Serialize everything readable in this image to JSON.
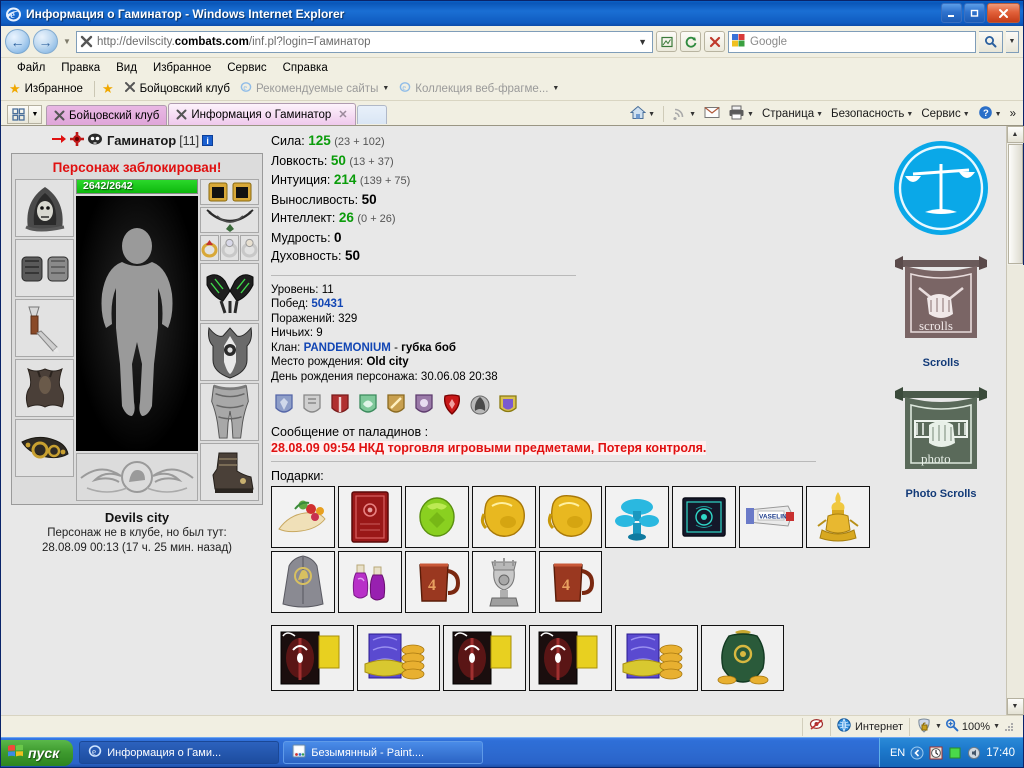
{
  "window": {
    "title": "Информация о Гаминатор - Windows Internet Explorer",
    "minimize": "–",
    "maximize": "□",
    "close": "✕"
  },
  "address": {
    "url_prefix": "http://devilscity.",
    "url_domain": "combats.com",
    "url_suffix": "/inf.pl?login=Гаминатор",
    "back_tooltip": "Назад",
    "forward_tooltip": "Вперед"
  },
  "search": {
    "placeholder": "Google"
  },
  "menu": {
    "items": [
      "Файл",
      "Правка",
      "Вид",
      "Избранное",
      "Сервис",
      "Справка"
    ]
  },
  "favorites_bar": {
    "favorites_label": "Избранное",
    "items": [
      {
        "label": "Бойцовский клуб",
        "dim": false,
        "caret": false
      },
      {
        "label": "Рекомендуемые сайты",
        "dim": true,
        "caret": true
      },
      {
        "label": "Коллекция веб-фрагме...",
        "dim": true,
        "caret": true
      }
    ]
  },
  "tabs": [
    {
      "label": "Бойцовский клуб",
      "active": false,
      "closable": false
    },
    {
      "label": "Информация о Гаминатор",
      "active": true,
      "closable": true
    }
  ],
  "command_bar": {
    "items": [
      {
        "label": "",
        "icon": "home-icon",
        "caret": true
      },
      {
        "label": "",
        "icon": "feeds-icon",
        "caret": true
      },
      {
        "label": "",
        "icon": "mail-icon",
        "caret": false
      },
      {
        "label": "",
        "icon": "print-icon",
        "caret": true
      },
      {
        "label": "Страница",
        "icon": "",
        "caret": true
      },
      {
        "label": "Безопасность",
        "icon": "",
        "caret": true
      },
      {
        "label": "Сервис",
        "icon": "",
        "caret": true
      },
      {
        "label": "",
        "icon": "help-icon",
        "caret": true
      }
    ],
    "overflow": "»"
  },
  "character": {
    "name": "Гаминатор",
    "level_bracket": "[11]",
    "info_badge": "i",
    "blocked_notice": "Персонаж заблокирован!",
    "hp": "2642/2642",
    "hp_percent": 100,
    "city": "Devils city",
    "club_line1": "Персонаж не в клубе, но был тут:",
    "club_line2": "28.08.09 00:13 (17 ч. 25 мин. назад)",
    "equipment_left": [
      "hood-item",
      "bracers-item",
      "dagger-item",
      "pelt-item",
      "belt-item"
    ],
    "equipment_right": [
      "earrings-item",
      "necklace-item",
      "rings-item",
      "gloves-item",
      "shield-item",
      "legs-item",
      "boots-item"
    ]
  },
  "stats": [
    {
      "label": "Сила:",
      "value": "125",
      "green": true,
      "detail": "(23 + 102)"
    },
    {
      "label": "Ловкость:",
      "value": "50",
      "green": true,
      "detail": "(13 + 37)"
    },
    {
      "label": "Интуиция:",
      "value": "214",
      "green": true,
      "detail": "(139 + 75)"
    },
    {
      "label": "Выносливость:",
      "value": "50",
      "green": false,
      "detail": ""
    },
    {
      "label": "Интеллект:",
      "value": "26",
      "green": true,
      "detail": "(0 + 26)"
    },
    {
      "label": "Мудрость:",
      "value": "0",
      "green": false,
      "detail": ""
    },
    {
      "label": "Духовность:",
      "value": "50",
      "green": false,
      "detail": ""
    }
  ],
  "profile": {
    "level_label": "Уровень:",
    "level_value": "11",
    "wins_label": "Побед:",
    "wins_value": "50431",
    "losses_label": "Поражений:",
    "losses_value": "329",
    "draws_label": "Ничьих:",
    "draws_value": "9",
    "clan_label": "Клан:",
    "clan_name": "PANDEMONIUM",
    "clan_sep": " - ",
    "clan_member": "губка боб",
    "birthplace_label": "Место рождения:",
    "birthplace_value": "Old city",
    "birthday_label": "День рождения персонажа:",
    "birthday_value": "30.06.08 20:38"
  },
  "medals": [
    {
      "name": "medal-blue",
      "color": "#8e9ec8",
      "accent": "#5566a8"
    },
    {
      "name": "medal-silver",
      "color": "#cfcfcf",
      "accent": "#888888"
    },
    {
      "name": "medal-red",
      "color": "#b03030",
      "accent": "#7a1c1c"
    },
    {
      "name": "medal-green",
      "color": "#7fc89a",
      "accent": "#3a8a5c"
    },
    {
      "name": "medal-gold",
      "color": "#c8a050",
      "accent": "#8a6a20"
    },
    {
      "name": "medal-purple",
      "color": "#9a7aa8",
      "accent": "#5e3c6e"
    },
    {
      "name": "medal-crimson",
      "color": "#c81818",
      "accent": "#8a0000"
    },
    {
      "name": "medal-grey-wing",
      "color": "#b8b8b8",
      "accent": "#6a6a6a"
    },
    {
      "name": "medal-violet",
      "color": "#7a5ad0",
      "accent": "#d8c050"
    }
  ],
  "paladin_message": {
    "title": "Сообщение от паладинов :",
    "text": "28.08.09 09:54 НКД торговля игровыми предметами, Потеря контроля."
  },
  "gifts": {
    "label": "Подарки:",
    "row1": [
      "cornucopia-gift",
      "red-book-gift",
      "green-gem-gift",
      "gold-glove-gift",
      "gold-glove-gift-2",
      "blue-mushroom-gift",
      "dark-book-gift",
      "vaseline-gift",
      "gold-lamp-gift"
    ],
    "row2": [
      "grey-cloak-gift",
      "purple-potion-gift",
      "beer-mug-gift",
      "silver-trophy-gift",
      "beer-mug-gift-2"
    ],
    "row3": [
      "black-flag-bag",
      "blue-coin-bag",
      "black-flag-bag-2",
      "black-flag-bag-3",
      "blue-coin-bag-2",
      "green-money-bag"
    ]
  },
  "sidebar": {
    "balance_icon": "balance-scales-icon",
    "scrolls_label": "Scrolls",
    "scrolls_badge_text": "scrolls",
    "photo_scrolls_label": "Photo Scrolls",
    "photo_badge_text": "photo"
  },
  "statusbar": {
    "zone": "Интернет",
    "zoom": "100%"
  },
  "taskbar": {
    "start": "пуск",
    "buttons": [
      {
        "label": "Информация о Гами...",
        "active": true,
        "icon": "ie-icon"
      },
      {
        "label": "Безымянный - Paint....",
        "active": false,
        "icon": "paint-icon"
      }
    ],
    "tray": {
      "language": "EN",
      "clock": "17:40"
    }
  }
}
